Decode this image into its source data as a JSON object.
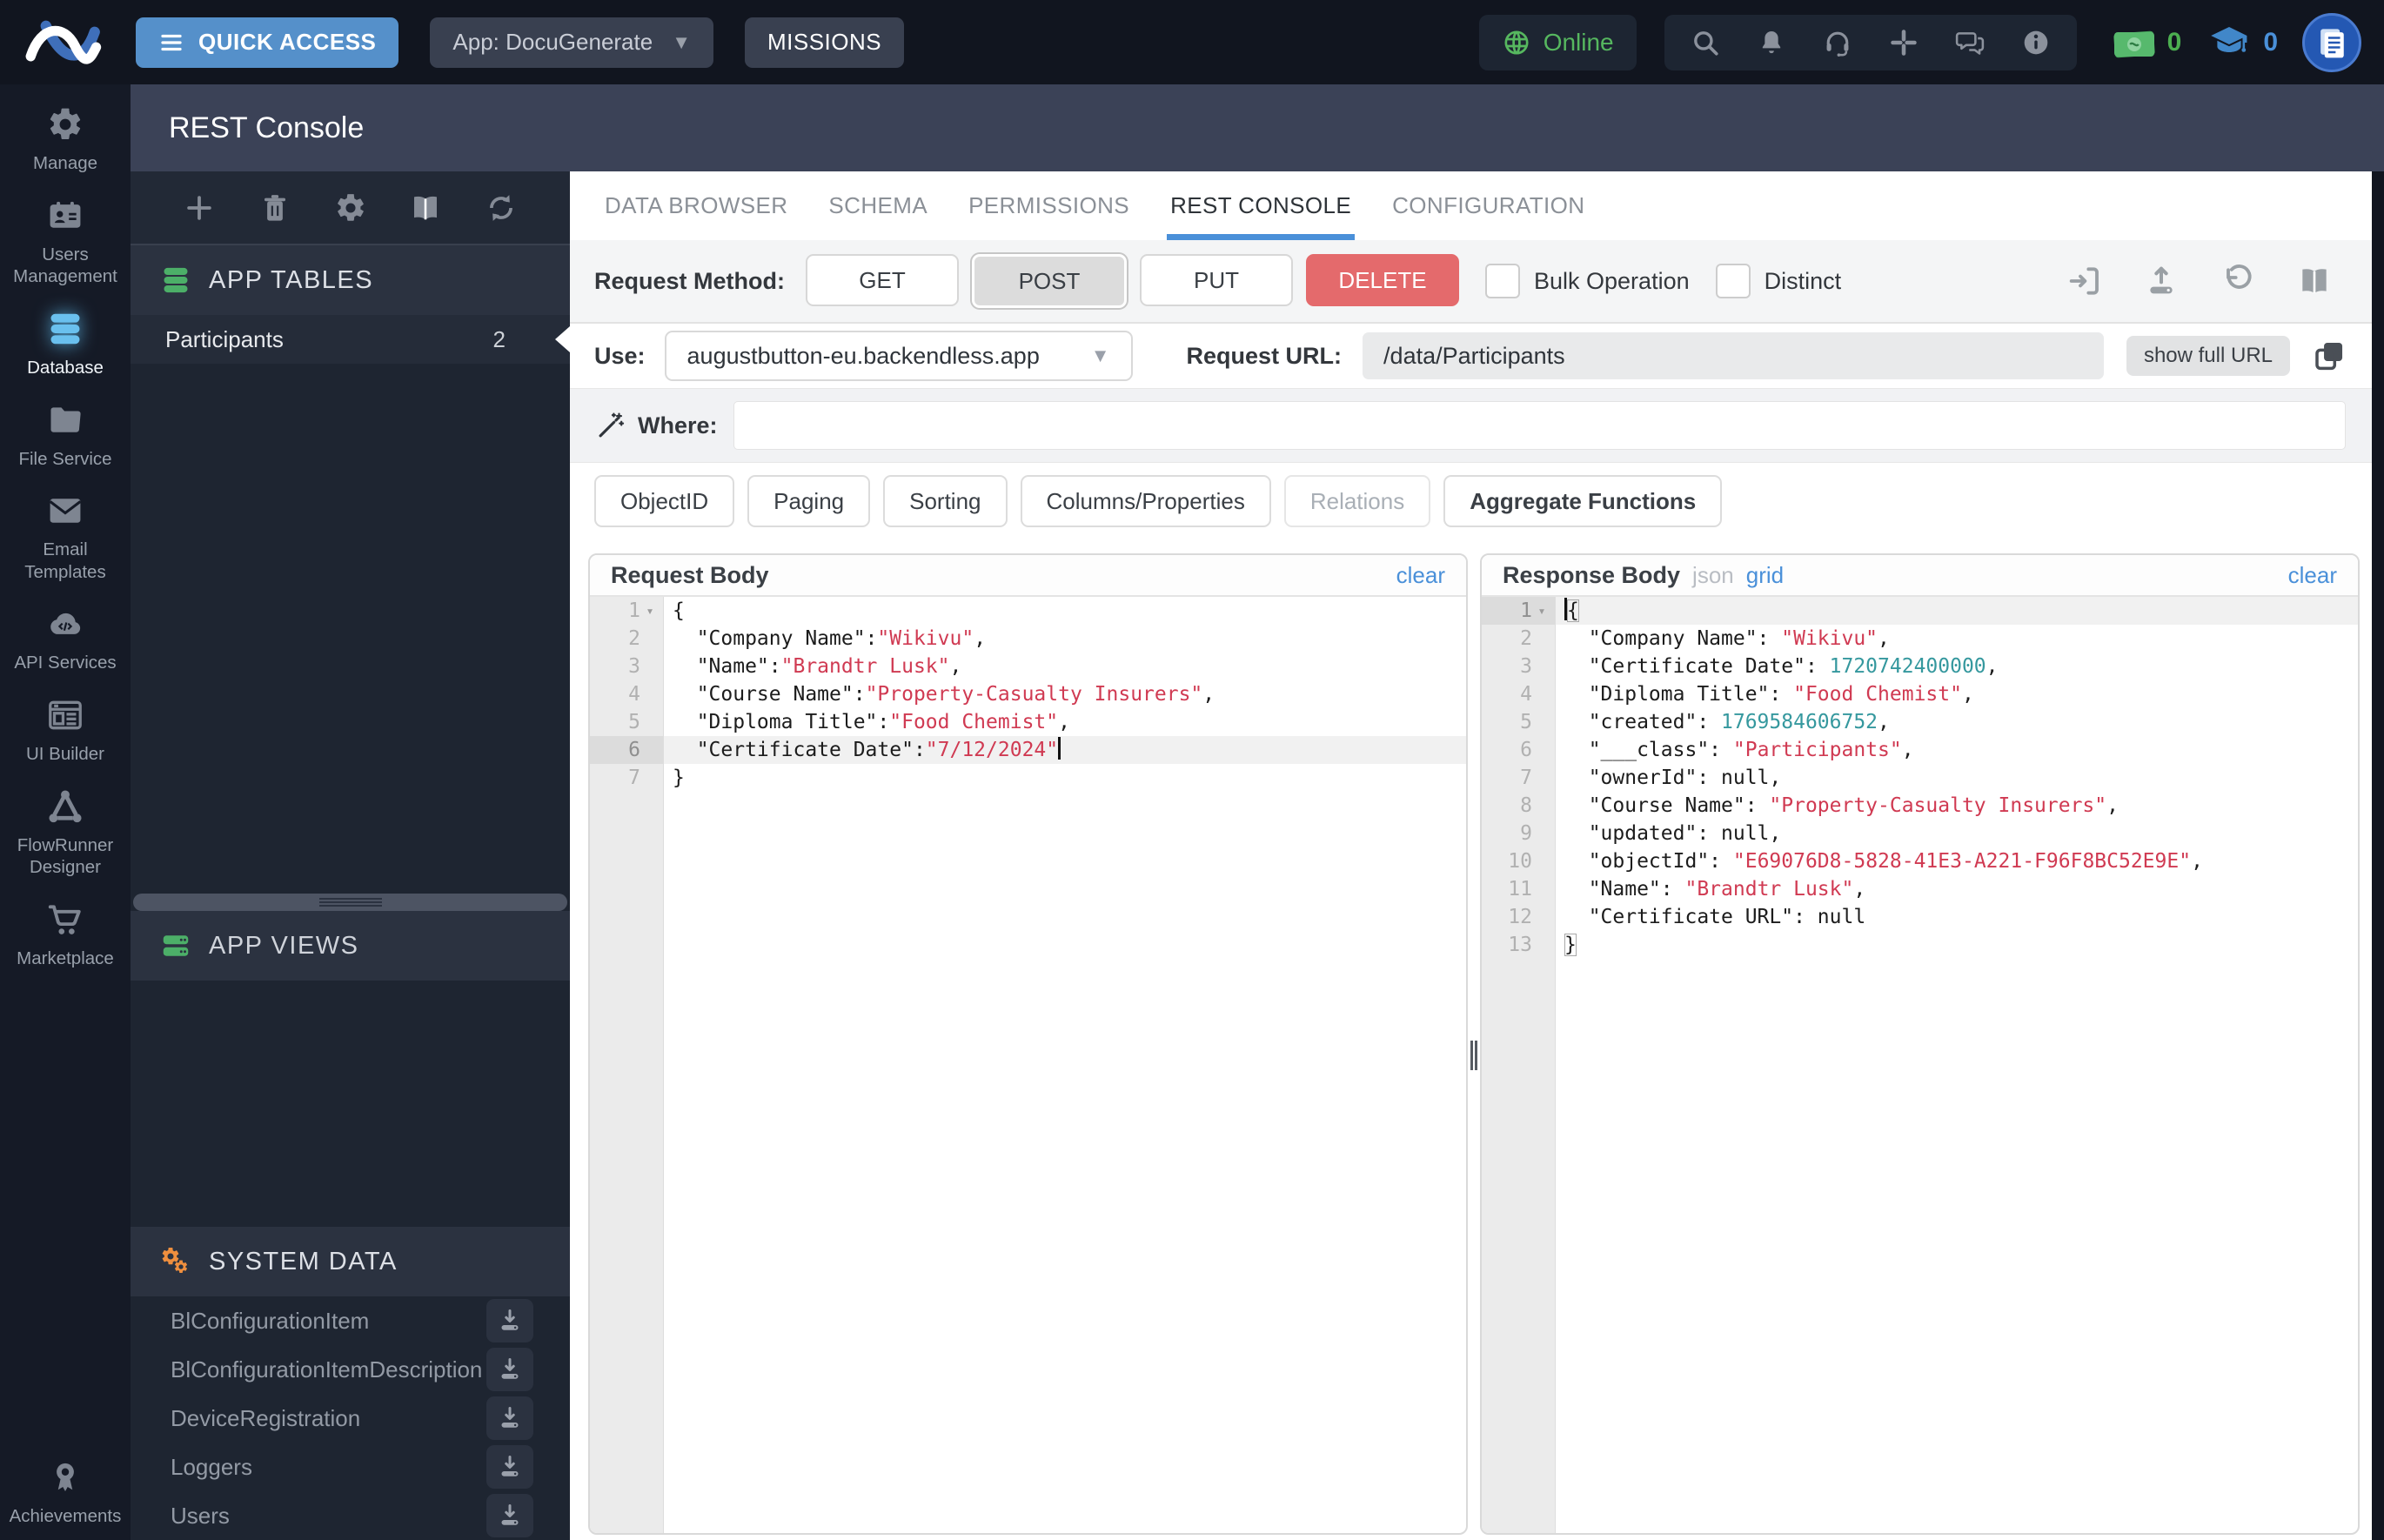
{
  "colors": {
    "accent": "#4a90d9",
    "delete_red": "#e46a6c",
    "online_green": "#56b75f",
    "string_red": "#d03a52",
    "number_teal": "#35989e",
    "active_sidebar_blue": "#6ac0ee",
    "tables_green": "#4caf68",
    "system_orange": "#ef8f3e"
  },
  "topbar": {
    "quick_access": "QUICK ACCESS",
    "app_selector": "App: DocuGenerate",
    "missions": "MISSIONS",
    "online": "Online",
    "bucks_count": "0",
    "learning_count": "0"
  },
  "header": {
    "title": "REST Console"
  },
  "sidebar": {
    "active": "Database",
    "items": [
      {
        "label": "Manage"
      },
      {
        "label": "Users Management"
      },
      {
        "label": "Database"
      },
      {
        "label": "File Service"
      },
      {
        "label": "Email Templates"
      },
      {
        "label": "API Services"
      },
      {
        "label": "UI Builder"
      },
      {
        "label": "FlowRunner Designer"
      },
      {
        "label": "Marketplace"
      },
      {
        "label": "Achievements"
      }
    ]
  },
  "tables": {
    "app_tables": "APP TABLES",
    "app_views": "APP VIEWS",
    "system_data": "SYSTEM DATA",
    "participants": {
      "name": "Participants",
      "count": "2"
    },
    "system_items": [
      "BlConfigurationItem",
      "BlConfigurationItemDescription",
      "DeviceRegistration",
      "Loggers",
      "Users"
    ]
  },
  "tabs": {
    "active": "REST CONSOLE",
    "items": [
      {
        "label": "DATA BROWSER"
      },
      {
        "label": "SCHEMA"
      },
      {
        "label": "PERMISSIONS"
      },
      {
        "label": "REST CONSOLE"
      },
      {
        "label": "CONFIGURATION"
      }
    ]
  },
  "request_bar": {
    "label": "Request Method:",
    "selected": "POST",
    "methods": [
      {
        "label": "GET"
      },
      {
        "label": "POST"
      },
      {
        "label": "PUT"
      },
      {
        "label": "DELETE"
      }
    ],
    "bulk_operation": "Bulk Operation",
    "distinct": "Distinct"
  },
  "use_row": {
    "label": "Use:",
    "value": "augustbutton-eu.backendless.app",
    "request_url_label": "Request URL:",
    "request_url": "/data/Participants",
    "show_full_url": "show full URL"
  },
  "where_row": {
    "label": "Where:",
    "value": "",
    "placeholder": ""
  },
  "filters": [
    {
      "label": "ObjectID"
    },
    {
      "label": "Paging"
    },
    {
      "label": "Sorting"
    },
    {
      "label": "Columns/Properties"
    },
    {
      "label": "Relations"
    },
    {
      "label": "Aggregate Functions"
    }
  ],
  "request_body": {
    "title": "Request Body",
    "clear": "clear",
    "lines": [
      {
        "fold": true,
        "tokens": [
          [
            "{",
            ""
          ]
        ]
      },
      {
        "tokens": [
          [
            "  \"Company Name\":",
            ""
          ],
          [
            "\"Wikivu\"",
            "s"
          ],
          [
            ",",
            ""
          ]
        ]
      },
      {
        "tokens": [
          [
            "  \"Name\":",
            ""
          ],
          [
            "\"Brandtr Lusk\"",
            "s"
          ],
          [
            ",",
            ""
          ]
        ]
      },
      {
        "tokens": [
          [
            "  \"Course Name\":",
            ""
          ],
          [
            "\"Property-Casualty Insurers\"",
            "s"
          ],
          [
            ",",
            ""
          ]
        ]
      },
      {
        "tokens": [
          [
            "  \"Diploma Title\":",
            ""
          ],
          [
            "\"Food Chemist\"",
            "s"
          ],
          [
            ",",
            ""
          ]
        ]
      },
      {
        "active": true,
        "caret": "end",
        "tokens": [
          [
            "  \"Certificate Date\":",
            ""
          ],
          [
            "\"7/12/2024\"",
            "s"
          ]
        ]
      },
      {
        "tokens": [
          [
            "}",
            ""
          ]
        ]
      }
    ]
  },
  "response_body": {
    "title": "Response Body",
    "json_label": "json",
    "grid_label": "grid",
    "clear": "clear",
    "lines": [
      {
        "fold": true,
        "active": true,
        "caret": "start",
        "tokens": [
          [
            "{",
            "m"
          ]
        ]
      },
      {
        "tokens": [
          [
            "  \"Company Name\": ",
            ""
          ],
          [
            "\"Wikivu\"",
            "s"
          ],
          [
            ",",
            ""
          ]
        ]
      },
      {
        "tokens": [
          [
            "  \"Certificate Date\": ",
            ""
          ],
          [
            "1720742400000",
            "n"
          ],
          [
            ",",
            ""
          ]
        ]
      },
      {
        "tokens": [
          [
            "  \"Diploma Title\": ",
            ""
          ],
          [
            "\"Food Chemist\"",
            "s"
          ],
          [
            ",",
            ""
          ]
        ]
      },
      {
        "tokens": [
          [
            "  \"created\": ",
            ""
          ],
          [
            "1769584606752",
            "n"
          ],
          [
            ",",
            ""
          ]
        ]
      },
      {
        "tokens": [
          [
            "  \"___class\": ",
            ""
          ],
          [
            "\"Participants\"",
            "s"
          ],
          [
            ",",
            ""
          ]
        ]
      },
      {
        "tokens": [
          [
            "  \"ownerId\": null,",
            ""
          ]
        ]
      },
      {
        "tokens": [
          [
            "  \"Course Name\": ",
            ""
          ],
          [
            "\"Property-Casualty Insurers\"",
            "s"
          ],
          [
            ",",
            ""
          ]
        ]
      },
      {
        "tokens": [
          [
            "  \"updated\": null,",
            ""
          ]
        ]
      },
      {
        "tokens": [
          [
            "  \"objectId\": ",
            ""
          ],
          [
            "\"E69076D8-5828-41E3-A221-F96F8BC52E9E\"",
            "s"
          ],
          [
            ",",
            ""
          ]
        ]
      },
      {
        "tokens": [
          [
            "  \"Name\": ",
            ""
          ],
          [
            "\"Brandtr Lusk\"",
            "s"
          ],
          [
            ",",
            ""
          ]
        ]
      },
      {
        "tokens": [
          [
            "  \"Certificate URL\": null",
            ""
          ]
        ]
      },
      {
        "tokens": [
          [
            "}",
            "m"
          ]
        ]
      }
    ]
  }
}
